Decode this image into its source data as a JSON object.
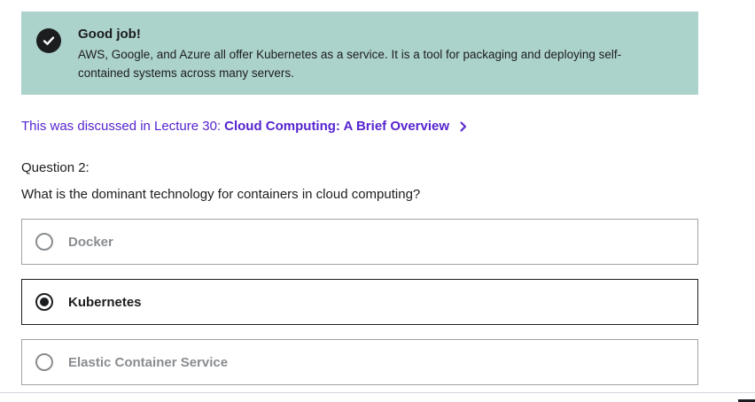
{
  "feedback": {
    "title": "Good job!",
    "body": "AWS, Google, and Azure all offer Kubernetes as a service. It is a tool for packaging and deploying self-contained systems across many servers.",
    "icon": "check-circle-icon",
    "background": "#acd2cc"
  },
  "lecture_link": {
    "prefix": "This was discussed in Lecture 30:",
    "title": "Cloud Computing: A Brief Overview",
    "icon": "chevron-right-icon",
    "color": "#5624d0"
  },
  "question": {
    "number_label": "Question 2:",
    "text": "What is the dominant technology for containers in cloud computing?"
  },
  "options": [
    {
      "label": "Docker",
      "selected": false
    },
    {
      "label": "Kubernetes",
      "selected": true
    },
    {
      "label": "Elastic Container Service",
      "selected": false
    }
  ]
}
